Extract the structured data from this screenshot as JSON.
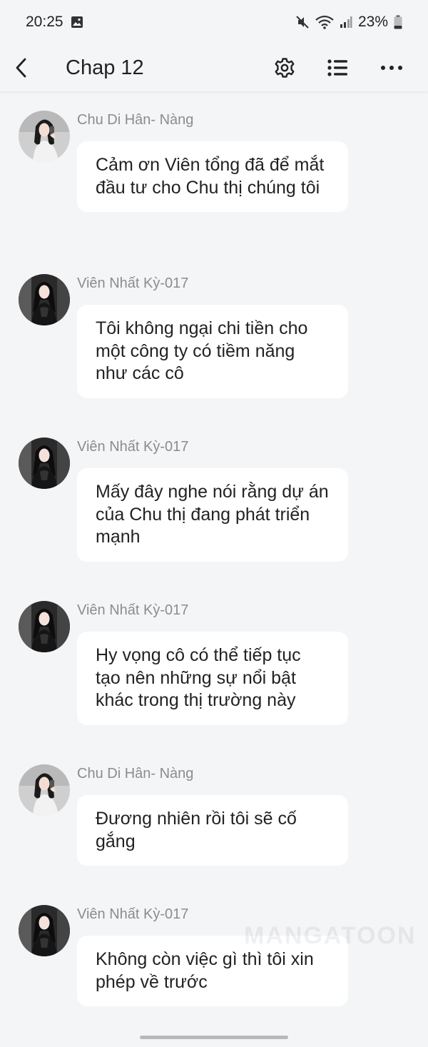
{
  "status_bar": {
    "time": "20:25",
    "battery": "23%"
  },
  "header": {
    "title": "Chap 12"
  },
  "messages": [
    {
      "sender": "Chu Di Hân- Nàng",
      "text": "Cảm ơn Viên tổng đã để mắt đầu tư cho Chu thị chúng tôi"
    },
    {
      "sender": "Viên Nhất Kỳ-017",
      "text": "Tôi không ngại chi tiền cho một công ty có tiềm năng như các cô"
    },
    {
      "sender": "Viên Nhất Kỳ-017",
      "text": "Mấy đây nghe nói rằng dự án của Chu thị đang phát triển mạnh"
    },
    {
      "sender": "Viên Nhất Kỳ-017",
      "text": "Hy vọng cô có thể tiếp tục tạo nên những sự nổi bật khác trong thị trường này"
    },
    {
      "sender": "Chu Di Hân- Nàng",
      "text": "Đương nhiên rồi tôi sẽ cố gắng"
    },
    {
      "sender": "Viên Nhất Kỳ-017",
      "text": "Không còn việc gì thì tôi xin phép về trước"
    }
  ],
  "watermark": "MANGATOON"
}
